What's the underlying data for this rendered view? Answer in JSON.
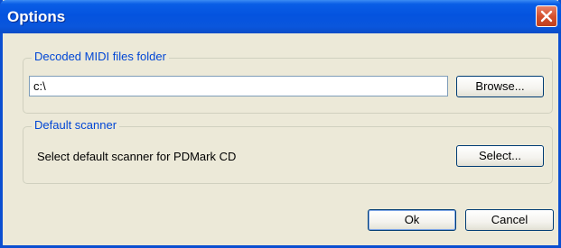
{
  "window": {
    "title": "Options"
  },
  "folder_group": {
    "legend": "Decoded MIDI files folder",
    "path_value": "c:\\",
    "browse_label": "Browse..."
  },
  "scanner_group": {
    "legend": "Default scanner",
    "description": "Select default scanner for PDMark CD",
    "select_label": "Select..."
  },
  "footer": {
    "ok_label": "Ok",
    "cancel_label": "Cancel"
  },
  "colors": {
    "titlebar": "#0453df",
    "dialog_bg": "#ece9d8",
    "legend_text": "#0046d5",
    "close_button": "#d5512e"
  }
}
